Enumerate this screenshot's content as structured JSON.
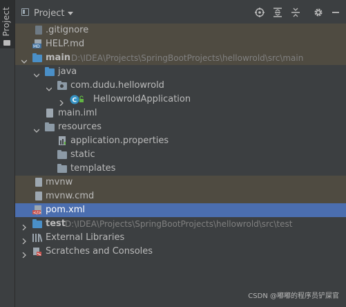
{
  "sidebar": {
    "tab_label": "Project"
  },
  "header": {
    "title": "Project",
    "icons": [
      "locate-icon",
      "expand-all-icon",
      "collapse-all-icon",
      "gear-icon",
      "hide-icon"
    ]
  },
  "tree": [
    {
      "label": ".gitignore",
      "icon": "gitignore-file-icon",
      "state": "ignored"
    },
    {
      "label": "HELP.md",
      "icon": "markdown-file-icon",
      "state": "ignored"
    },
    {
      "label": "main",
      "path": "D:\\IDEA\\Projects\\SpringBootProjects\\hellowrold\\src\\main",
      "icon": "module-folder-icon",
      "expanded": true,
      "state": "ignored"
    },
    {
      "label": "java",
      "icon": "source-folder-icon",
      "expanded": true
    },
    {
      "label": "com.dudu.hellowrold",
      "icon": "package-icon",
      "expanded": true
    },
    {
      "label": "HellowroldApplication",
      "icon": "spring-class-icon",
      "expanded": false
    },
    {
      "label": "main.iml",
      "icon": "iml-file-icon"
    },
    {
      "label": "resources",
      "icon": "resources-folder-icon",
      "expanded": true
    },
    {
      "label": "application.properties",
      "icon": "properties-file-icon"
    },
    {
      "label": "static",
      "icon": "folder-icon"
    },
    {
      "label": "templates",
      "icon": "folder-icon"
    },
    {
      "label": "mvnw",
      "icon": "file-icon",
      "state": "ignored"
    },
    {
      "label": "mvnw.cmd",
      "icon": "file-icon",
      "state": "ignored"
    },
    {
      "label": "pom.xml",
      "icon": "maven-file-icon",
      "state": "selected"
    },
    {
      "label": "test",
      "path": "D:\\IDEA\\Projects\\SpringBootProjects\\hellowrold\\src\\test",
      "icon": "module-folder-icon",
      "expanded": false
    },
    {
      "label": "External Libraries",
      "icon": "libraries-icon",
      "expanded": false
    },
    {
      "label": "Scratches and Consoles",
      "icon": "scratches-icon",
      "expanded": false
    }
  ],
  "watermark": "CSDN @嘟嘟的程序员铲屎官",
  "colors": {
    "background": "#3c3f41",
    "ignored_row": "#4f4b41",
    "selected_row": "#4b6eaf",
    "path_text": "#808080"
  }
}
